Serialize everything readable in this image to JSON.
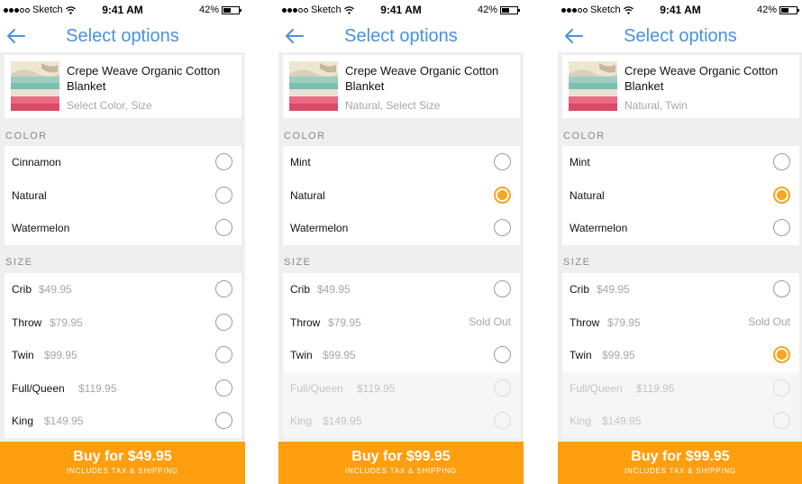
{
  "screens": [
    {
      "status": {
        "carrier": "Sketch",
        "time": "9:41 AM",
        "battery": "42%"
      },
      "title": "Select options",
      "product": {
        "name": "Crepe Weave Organic Cotton Blanket",
        "selection": "Select Color, Size"
      },
      "color_label": "COLOR",
      "colors": [
        {
          "name": "Cinnamon",
          "selected": false
        },
        {
          "name": "Natural",
          "selected": false
        },
        {
          "name": "Watermelon",
          "selected": false
        }
      ],
      "size_label": "SIZE",
      "sizes": [
        {
          "name": "Crib",
          "price": "$49.95",
          "selected": false,
          "disabled": false
        },
        {
          "name": "Throw",
          "price": "$79.95",
          "selected": false,
          "disabled": false
        },
        {
          "name": "Twin",
          "price": "$99.95",
          "selected": false,
          "disabled": false
        },
        {
          "name": "Full/Queen",
          "price": "$119.95",
          "selected": false,
          "disabled": false
        },
        {
          "name": "King",
          "price": "$149.95",
          "selected": false,
          "disabled": false
        }
      ],
      "buy": {
        "label": "Buy for $49.95",
        "sub": "INCLUDES TAX & SHIPPING"
      }
    },
    {
      "status": {
        "carrier": "Sketch",
        "time": "9:41 AM",
        "battery": "42%"
      },
      "title": "Select options",
      "product": {
        "name": "Crepe Weave Organic Cotton Blanket",
        "selection": "Natural, Select Size"
      },
      "color_label": "COLOR",
      "colors": [
        {
          "name": "Mint",
          "selected": false
        },
        {
          "name": "Natural",
          "selected": true
        },
        {
          "name": "Watermelon",
          "selected": false
        }
      ],
      "size_label": "SIZE",
      "sizes": [
        {
          "name": "Crib",
          "price": "$49.95",
          "selected": false,
          "disabled": false
        },
        {
          "name": "Throw",
          "price": "$79.95",
          "selected": false,
          "disabled": false,
          "sold_out": "Sold Out"
        },
        {
          "name": "Twin",
          "price": "$99.95",
          "selected": false,
          "disabled": false
        },
        {
          "name": "Full/Queen",
          "price": "$119.95",
          "selected": false,
          "disabled": true
        },
        {
          "name": "King",
          "price": "$149.95",
          "selected": false,
          "disabled": true
        }
      ],
      "buy": {
        "label": "Buy for $99.95",
        "sub": "INCLUDES TAX & SHIPPING"
      }
    },
    {
      "status": {
        "carrier": "Sketch",
        "time": "9:41 AM",
        "battery": "42%"
      },
      "title": "Select options",
      "product": {
        "name": "Crepe Weave Organic Cotton Blanket",
        "selection": "Natural, Twin"
      },
      "color_label": "COLOR",
      "colors": [
        {
          "name": "Mint",
          "selected": false
        },
        {
          "name": "Natural",
          "selected": true
        },
        {
          "name": "Watermelon",
          "selected": false
        }
      ],
      "size_label": "SIZE",
      "sizes": [
        {
          "name": "Crib",
          "price": "$49.95",
          "selected": false,
          "disabled": false
        },
        {
          "name": "Throw",
          "price": "$79.95",
          "selected": false,
          "disabled": false,
          "sold_out": "Sold Out"
        },
        {
          "name": "Twin",
          "price": "$99.95",
          "selected": true,
          "disabled": false
        },
        {
          "name": "Full/Queen",
          "price": "$119.95",
          "selected": false,
          "disabled": true
        },
        {
          "name": "King",
          "price": "$149.95",
          "selected": false,
          "disabled": true
        }
      ],
      "buy": {
        "label": "Buy for $99.95",
        "sub": "INCLUDES TAX & SHIPPING"
      }
    }
  ],
  "colors_ui": {
    "accent": "#4a90e2",
    "buy_button": "#ff9e0e",
    "selected_radio": "#f5a623"
  },
  "icons": {
    "back": "back-arrow-icon",
    "wifi": "wifi-icon",
    "battery": "battery-icon",
    "signal": "signal-dots-icon"
  }
}
